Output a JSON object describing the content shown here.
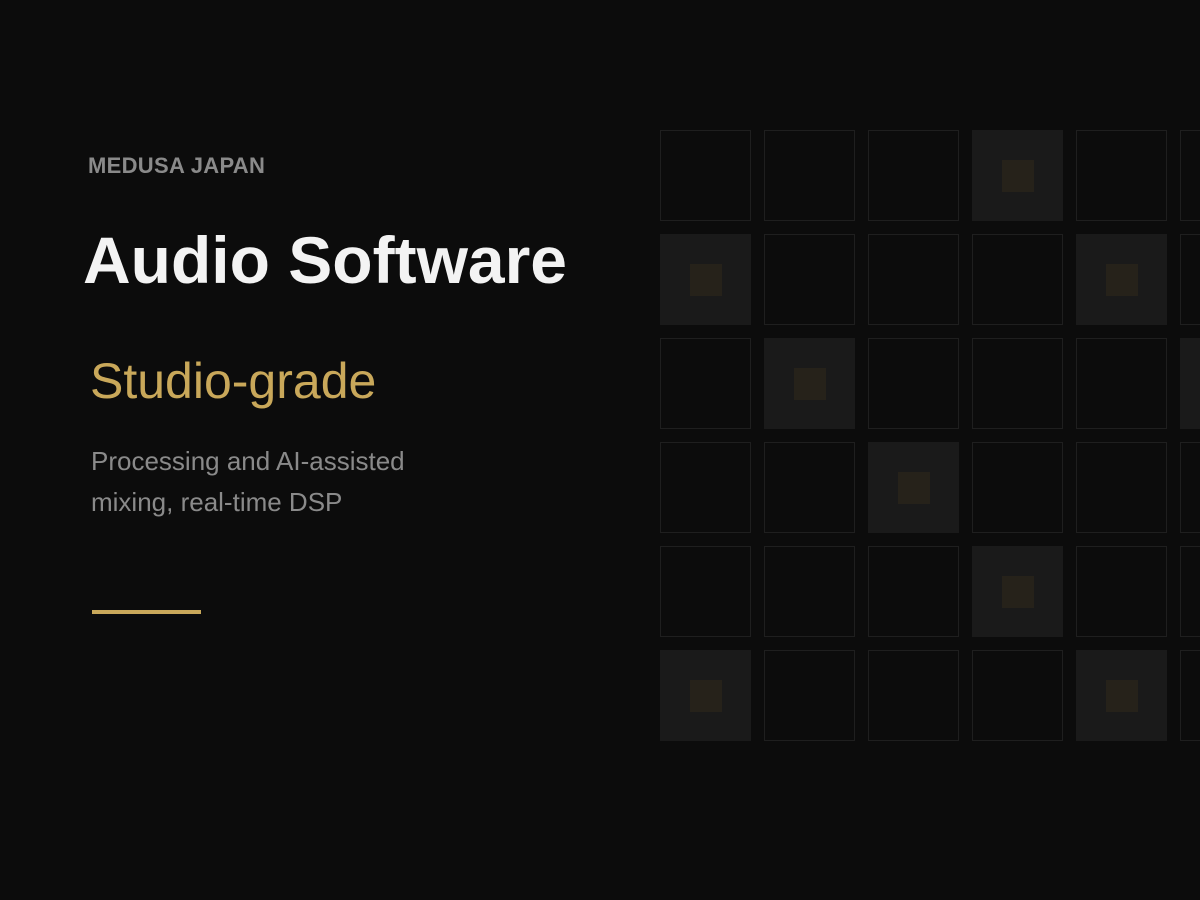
{
  "brand": "MEDUSA JAPAN",
  "title": "Audio Software",
  "subtitle": "Studio-grade",
  "description": {
    "line1": "Processing and AI-assisted",
    "line2": "mixing, real-time DSP"
  },
  "colors": {
    "background": "#0c0c0c",
    "accent": "#c9a85a",
    "title": "#f3f3f3",
    "muted": "#8a8a8a"
  },
  "grid": {
    "rows": 6,
    "cols": 6,
    "active_cells": [
      [
        0,
        3
      ],
      [
        1,
        0
      ],
      [
        1,
        4
      ],
      [
        2,
        1
      ],
      [
        2,
        5
      ],
      [
        3,
        2
      ],
      [
        4,
        3
      ],
      [
        5,
        0
      ],
      [
        5,
        4
      ]
    ]
  }
}
